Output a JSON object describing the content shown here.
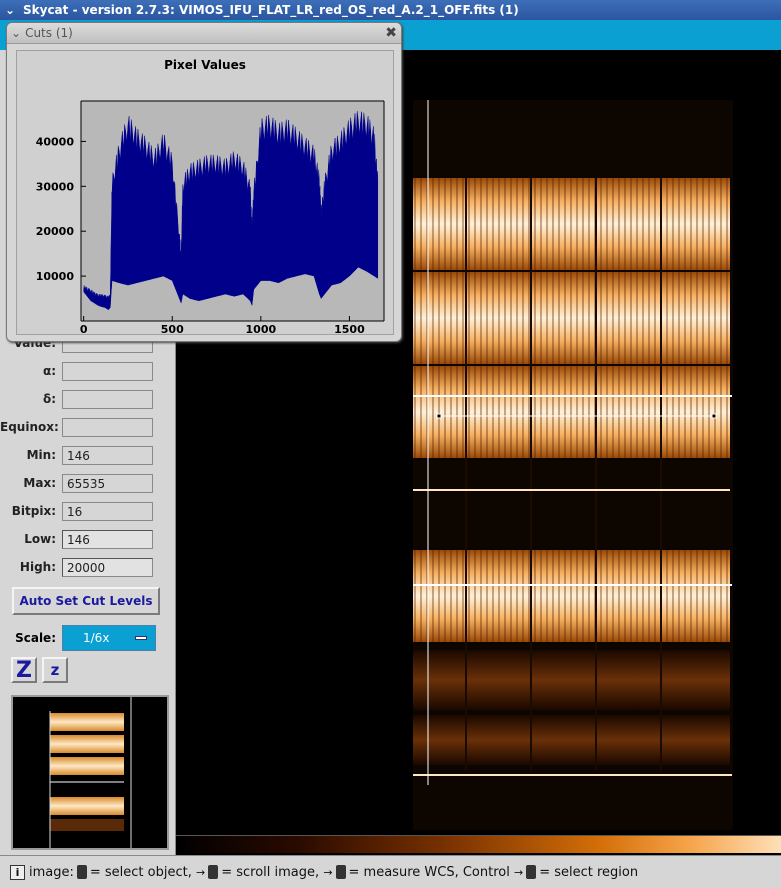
{
  "window": {
    "title": "Skycat - version 2.7.3: VIMOS_IFU_FLAT_LR_red_OS_red_A.2_1_OFF.fits (1)",
    "menu_icon": "chevron-down-icon"
  },
  "cuts_dialog": {
    "title": "Cuts (1)",
    "close_glyph": "✖",
    "menu_glyph": "⌄"
  },
  "fields": {
    "value_label": "Value:",
    "value": "",
    "alpha_label": "α:",
    "alpha": "",
    "delta_label": "δ:",
    "delta": "",
    "equinox_label": "Equinox:",
    "equinox": "",
    "min_label": "Min:",
    "min": "146",
    "max_label": "Max:",
    "max": "65535",
    "bitpix_label": "Bitpix:",
    "bitpix": "16",
    "low_label": "Low:",
    "low": "146",
    "high_label": "High:",
    "high": "20000"
  },
  "buttons": {
    "auto_cut": "Auto Set Cut Levels",
    "zoom_in": "Z",
    "zoom_out": "z"
  },
  "scale": {
    "label": "Scale:",
    "value": "1/6x"
  },
  "status": {
    "prefix": "image:",
    "part1": "= select object,",
    "part2": "= scroll image,",
    "part3": "= measure WCS, Control",
    "part4": "= select region"
  },
  "chart_data": {
    "type": "area",
    "title": "Pixel Values",
    "xlabel": "",
    "ylabel": "",
    "xlim": [
      -15,
      1695
    ],
    "ylim": [
      0,
      49000
    ],
    "xticks": [
      0,
      500,
      1000,
      1500
    ],
    "yticks": [
      10000,
      20000,
      30000,
      40000
    ],
    "grid": false,
    "color": "#00008b",
    "series": [
      {
        "x": [
          0,
          20,
          40,
          60,
          80,
          100,
          120,
          140,
          150,
          160,
          200,
          250,
          300,
          350,
          400,
          450,
          500,
          540,
          550,
          560,
          600,
          650,
          700,
          750,
          800,
          850,
          900,
          940,
          950,
          960,
          1000,
          1050,
          1100,
          1150,
          1200,
          1250,
          1300,
          1330,
          1340,
          1360,
          1400,
          1450,
          1500,
          1550,
          1600,
          1640,
          1660
        ],
        "lower": [
          6500,
          5500,
          4500,
          4000,
          3500,
          3200,
          3000,
          2500,
          3000,
          9000,
          8500,
          8000,
          8500,
          9000,
          9500,
          10000,
          9000,
          5000,
          4000,
          6000,
          5000,
          4500,
          5000,
          5500,
          6000,
          5500,
          6000,
          4500,
          3500,
          7000,
          9000,
          9000,
          8500,
          9500,
          10000,
          10500,
          10000,
          6000,
          5000,
          6000,
          8000,
          8500,
          10000,
          12000,
          11000,
          10000,
          9500
        ],
        "upper": [
          8000,
          7500,
          7000,
          6500,
          6000,
          6000,
          5800,
          5500,
          6000,
          32000,
          40000,
          46000,
          43000,
          41000,
          38000,
          42000,
          37000,
          20000,
          15000,
          32000,
          35000,
          36000,
          37000,
          37000,
          36000,
          38000,
          36000,
          31000,
          22000,
          30000,
          45000,
          46000,
          44000,
          45000,
          43000,
          41000,
          39000,
          33000,
          25000,
          32000,
          40000,
          42000,
          45000,
          47000,
          46000,
          43000,
          32000
        ]
      }
    ]
  }
}
